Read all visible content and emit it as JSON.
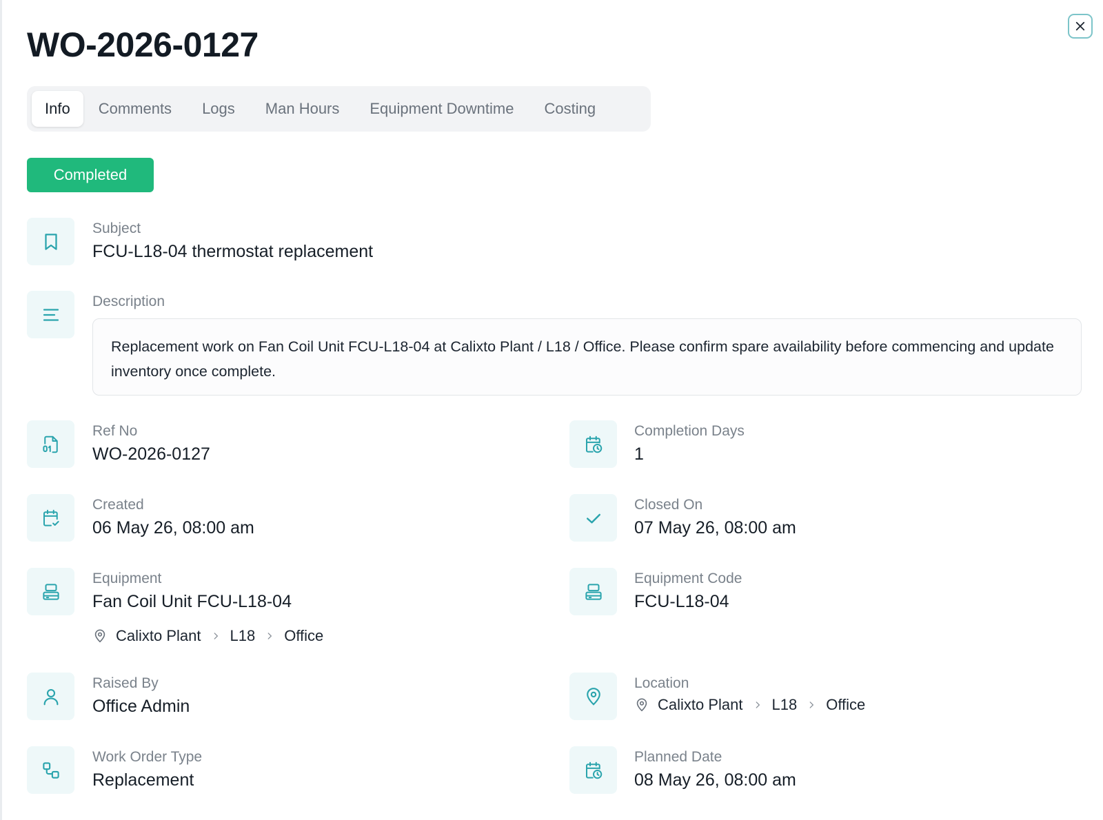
{
  "title": "WO-2026-0127",
  "tabs": [
    "Info",
    "Comments",
    "Logs",
    "Man Hours",
    "Equipment Downtime",
    "Costing"
  ],
  "active_tab": "Info",
  "status": "Completed",
  "colors": {
    "status": "#20b97c",
    "accent": "#2aa4ad",
    "icon_bg": "#eef8f9"
  },
  "subject": {
    "label": "Subject",
    "value": "FCU-L18-04 thermostat replacement",
    "icon": "bookmark-icon"
  },
  "description": {
    "label": "Description",
    "value": "Replacement work on Fan Coil Unit FCU-L18-04 at Calixto Plant / L18 / Office. Please confirm spare availability before commencing and update inventory once complete.",
    "icon": "align-left-icon"
  },
  "ref_no": {
    "label": "Ref No",
    "value": "WO-2026-0127",
    "icon": "file-number-icon"
  },
  "completion_days": {
    "label": "Completion Days",
    "value": "1",
    "icon": "calendar-clock-icon"
  },
  "created": {
    "label": "Created",
    "value": "06 May 26, 08:00 am",
    "icon": "calendar-check-icon"
  },
  "closed_on": {
    "label": "Closed On",
    "value": "07 May 26, 08:00 am",
    "icon": "check-icon"
  },
  "equipment": {
    "label": "Equipment",
    "value": "Fan Coil Unit FCU-L18-04",
    "icon": "server-icon",
    "path": [
      "Calixto Plant",
      "L18",
      "Office"
    ]
  },
  "equipment_code": {
    "label": "Equipment Code",
    "value": "FCU-L18-04",
    "icon": "server-icon"
  },
  "raised_by": {
    "label": "Raised By",
    "value": "Office Admin",
    "icon": "user-icon"
  },
  "location": {
    "label": "Location",
    "icon": "map-pin-icon",
    "path": [
      "Calixto Plant",
      "L18",
      "Office"
    ]
  },
  "work_order_type": {
    "label": "Work Order Type",
    "value": "Replacement",
    "icon": "workflow-icon"
  },
  "planned_date": {
    "label": "Planned Date",
    "value": "08 May 26, 08:00 am",
    "icon": "calendar-clock-icon"
  }
}
